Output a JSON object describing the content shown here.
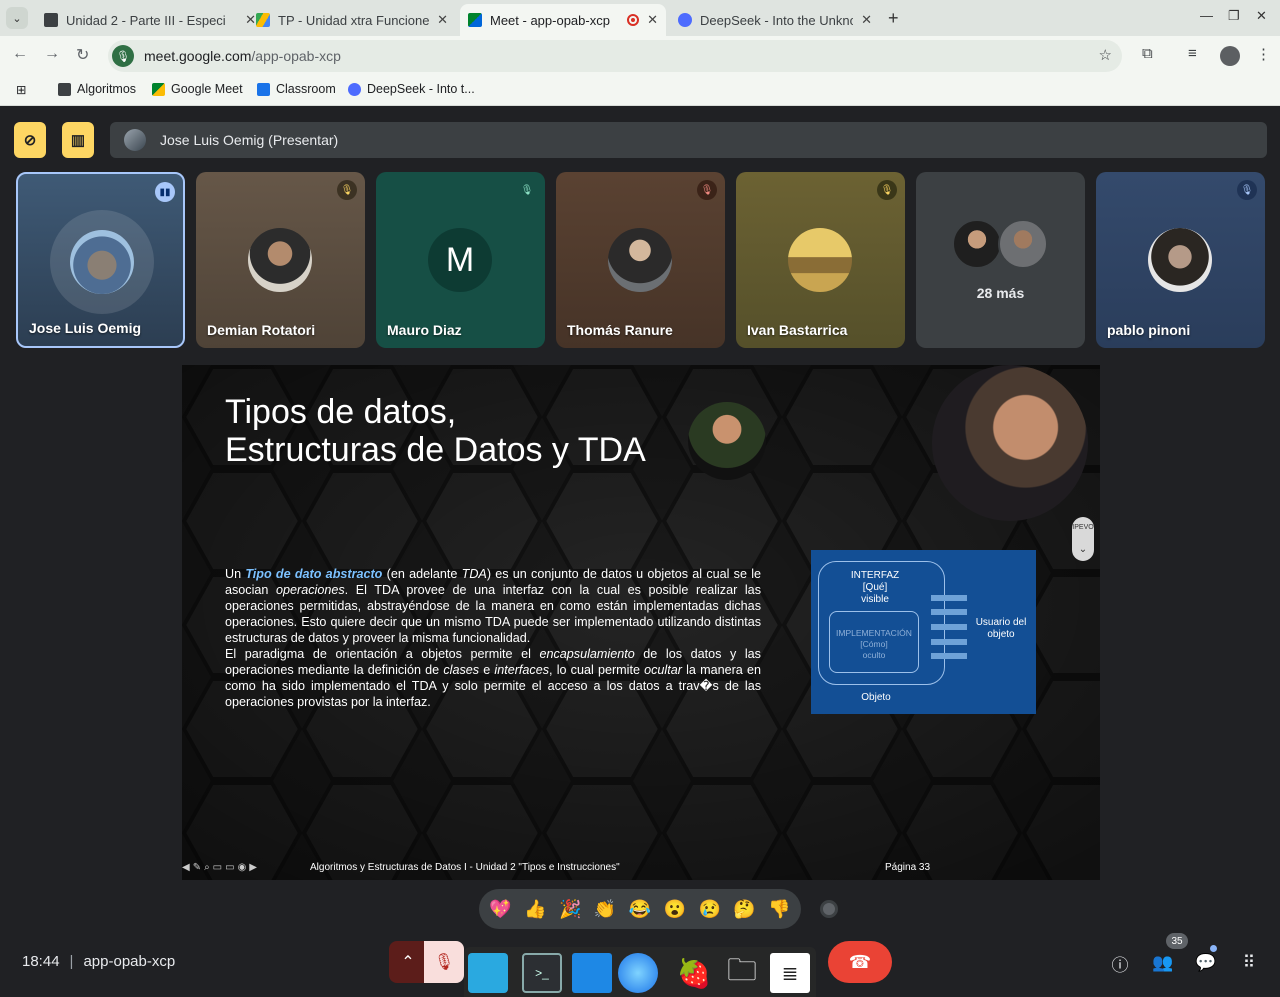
{
  "browser": {
    "tabs": [
      {
        "title": "Unidad 2 - Parte III - Especi",
        "active": false
      },
      {
        "title": "TP - Unidad xtra Funciones",
        "active": false
      },
      {
        "title": "Meet - app-opab-xcp",
        "active": true
      },
      {
        "title": "DeepSeek - Into the Unkno",
        "active": false
      }
    ],
    "url_host": "meet.google.com",
    "url_path": "/app-opab-xcp",
    "bookmarks": [
      "Algoritmos",
      "Google Meet",
      "Classroom",
      "DeepSeek - Into t..."
    ]
  },
  "meet": {
    "presenter_label": "Jose Luis Oemig (Presentar)",
    "participants": [
      {
        "name": "Jose Luis Oemig",
        "speaking": true
      },
      {
        "name": "Demian Rotatori",
        "muted": true
      },
      {
        "name": "Mauro Diaz",
        "initial": "M",
        "muted": true
      },
      {
        "name": "Thomás Ranure",
        "muted": true
      },
      {
        "name": "Ivan Bastarrica",
        "muted": true
      },
      {
        "name": "pablo pinoni",
        "muted": true
      }
    ],
    "more_label": "28 más",
    "time": "18:44",
    "meeting_code": "app-opab-xcp",
    "participant_count": "35",
    "colors": {
      "accent_yellow": "#fdd663",
      "hangup_red": "#ea4335",
      "speaking_border": "#a8c7fa"
    }
  },
  "slide": {
    "title_line1": "Tipos de datos,",
    "title_line2": "Estructuras de Datos y TDA",
    "p1_a": "Un ",
    "p1_term": "Tipo de dato abstracto",
    "p1_b": " (en adelante ",
    "p1_tda": "TDA",
    "p1_c": ") es un conjunto de datos u objetos al cual se le asocian ",
    "p1_ops": "operaciones",
    "p1_d": ". El TDA provee de una interfaz con la cual es posible realizar las operaciones permitidas, abstrayéndose de la manera en como están implementadas dichas operaciones. Esto quiere decir que un mismo TDA puede ser implementado utilizando distintas estructuras de datos y proveer la misma funcionalidad.",
    "p2_a": "El paradigma de orientación a objetos permite el ",
    "p2_enc": "encapsulamiento",
    "p2_b": " de los datos y las operaciones mediante la definición de ",
    "p2_cls": "clases",
    "p2_c": " e ",
    "p2_ifc": "interfaces",
    "p2_d": ", lo cual permite ",
    "p2_oc": "ocultar",
    "p2_e": " la manera en como ha sido implementado el TDA y solo permite el acceso a los datos a trav�s de las operaciones provistas por la interfaz.",
    "diagram": {
      "interface": "INTERFAZ\n[Qué]\nvisible",
      "implementation": "IMPLEMENTACIÓN\n[Cómo]\noculto",
      "user": "Usuario del\nobjeto",
      "object": "Objeto"
    },
    "footer_text": "Algoritmos y Estructuras de Datos I - Unidad 2 \"Tipos e Instrucciones\"",
    "page": "Página 33",
    "cam_label": "IPEVO"
  },
  "reactions": [
    "💖",
    "👍",
    "🎉",
    "👏",
    "😂",
    "😮",
    "😢",
    "🤔",
    "👎"
  ]
}
